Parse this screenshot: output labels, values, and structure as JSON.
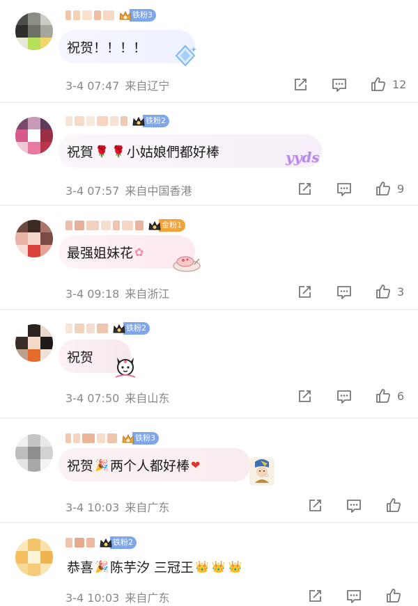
{
  "comments": [
    {
      "fan_badge": "铁粉3",
      "badge_color": "#7fa6e8",
      "text": "祝贺！！！！",
      "date": "3-4 07:47",
      "location": "来自辽宁",
      "likes": "12",
      "icons": [
        "share-icon",
        "reply-icon",
        "like-icon"
      ]
    },
    {
      "fan_badge": "铁粉2",
      "badge_color": "#7fa6e8",
      "text_parts": [
        "祝賀",
        "小姑娘們都好棒"
      ],
      "emoji": "rose",
      "deco_text": "yyds",
      "date": "3-4 07:57",
      "location": "来自中国香港",
      "likes": "9"
    },
    {
      "fan_badge": "金粉1",
      "badge_color": "#f2a23c",
      "text": "最强姐妹花",
      "date": "3-4 09:18",
      "location": "来自浙江",
      "likes": "3"
    },
    {
      "fan_badge": "铁粉2",
      "badge_color": "#7fa6e8",
      "text": "祝贺",
      "date": "3-4 07:50",
      "location": "来自山东",
      "likes": "6"
    },
    {
      "fan_badge": "铁粉3",
      "badge_color": "#7fa6e8",
      "text_parts": [
        "祝贺",
        "两个人都好棒"
      ],
      "date": "3-4 10:03",
      "location": "来自广东",
      "likes": ""
    },
    {
      "fan_badge": "铁粉2",
      "badge_color": "#7fa6e8",
      "text_parts": [
        "恭喜",
        "陈芋汐 三冠王"
      ],
      "date": "3-4 10:03",
      "location": "来自广东",
      "likes": ""
    }
  ]
}
